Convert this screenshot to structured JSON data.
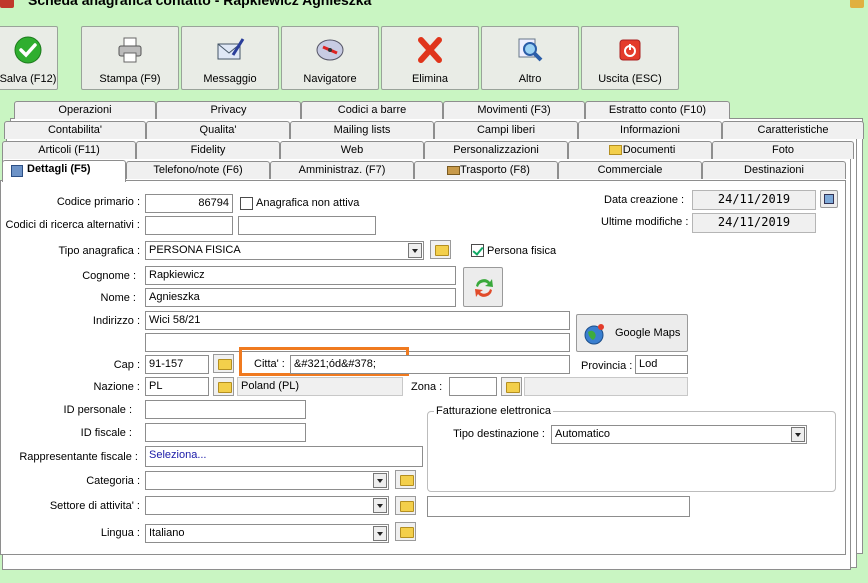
{
  "title_bar": {
    "text": "Scheda anagrafica contatto - Rapkiewicz Agnieszka"
  },
  "toolbar": {
    "save": "Salva (F12)",
    "print": "Stampa (F9)",
    "message": "Messaggio",
    "navigator": "Navigatore",
    "delete": "Elimina",
    "other": "Altro",
    "exit": "Uscita (ESC)"
  },
  "tabs": {
    "row1": [
      "Operazioni",
      "Privacy",
      "Codici a barre",
      "Movimenti (F3)",
      "Estratto conto (F10)"
    ],
    "row2": [
      "Contabilita'",
      "Qualita'",
      "Mailing lists",
      "Campi liberi",
      "Informazioni",
      "Caratteristiche"
    ],
    "row3": [
      "Articoli (F11)",
      "Fidelity",
      "Web",
      "Personalizzazioni",
      "Documenti",
      "Foto"
    ],
    "row4": [
      "Dettagli (F5)",
      "Telefono/note (F6)",
      "Amministraz. (F7)",
      "Trasporto (F8)",
      "Commerciale",
      "Destinazioni"
    ]
  },
  "form": {
    "codice_primario_label": "Codice primario :",
    "codice_primario_value": "86794",
    "anagrafica_non_attiva_label": "Anagrafica non attiva",
    "codici_ricerca_label": "Codici di ricerca alternativi :",
    "tipo_anagrafica_label": "Tipo anagrafica :",
    "tipo_anagrafica_value": "PERSONA FISICA",
    "persona_fisica_label": "Persona fisica",
    "cognome_label": "Cognome :",
    "cognome_value": "Rapkiewicz",
    "nome_label": "Nome :",
    "nome_value": "Agnieszka",
    "indirizzo_label": "Indirizzo :",
    "indirizzo_value": "Wici 58/21",
    "google_maps_label": "Google Maps",
    "cap_label": "Cap :",
    "cap_value": "91-157",
    "citta_label": "Citta' :",
    "citta_value": "&#321;ód&#378;",
    "provincia_label": "Provincia :",
    "provincia_value": "Lod",
    "nazione_label": "Nazione :",
    "nazione_code": "PL",
    "nazione_name": "Poland (PL)",
    "zona_label": "Zona :",
    "id_personale_label": "ID personale :",
    "id_fiscale_label": "ID fiscale :",
    "rappresentante_label": "Rappresentante fiscale :",
    "rappresentante_value": "Seleziona...",
    "categoria_label": "Categoria :",
    "settore_label": "Settore di attivita' :",
    "lingua_label": "Lingua :",
    "lingua_value": "Italiano",
    "data_creazione_label": "Data creazione :",
    "data_creazione_value": "24/11/2019",
    "ultime_modifiche_label": "Ultime modifiche :",
    "ultime_modifiche_value": "24/11/2019",
    "fatturazione_legend": "Fatturazione elettronica",
    "tipo_destinazione_label": "Tipo destinazione :",
    "tipo_destinazione_value": "Automatico"
  }
}
